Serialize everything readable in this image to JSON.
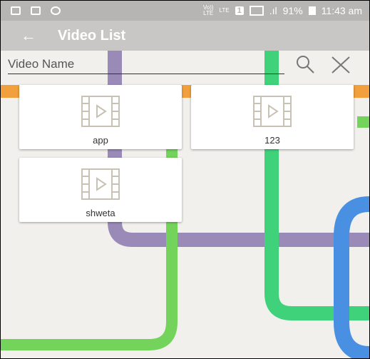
{
  "status_bar": {
    "lte_top": "Vo))",
    "lte_bottom": "LTE",
    "lte2": "LTE",
    "sim_slot": "1",
    "battery": "91%",
    "time": "11:43 am"
  },
  "app_bar": {
    "back_icon": "arrow-left-icon",
    "title": "Video List"
  },
  "search": {
    "placeholder": "Video Name",
    "value": ""
  },
  "videos": [
    {
      "name": "app",
      "icon": "film-play-icon"
    },
    {
      "name": "123",
      "icon": "film-play-icon"
    },
    {
      "name": "shweta",
      "icon": "film-play-icon"
    }
  ],
  "colors": {
    "status_bar": "#b7b5b3",
    "app_bar": "#c9c7c5",
    "map_bg": "#f2f0ed",
    "route_purple": "#9a8ab8",
    "route_green": "#3fd27a",
    "route_lime": "#74d35a",
    "route_blue": "#4a90e2",
    "route_orange": "#f2a03d",
    "film_icon": "#c8c2b4"
  }
}
